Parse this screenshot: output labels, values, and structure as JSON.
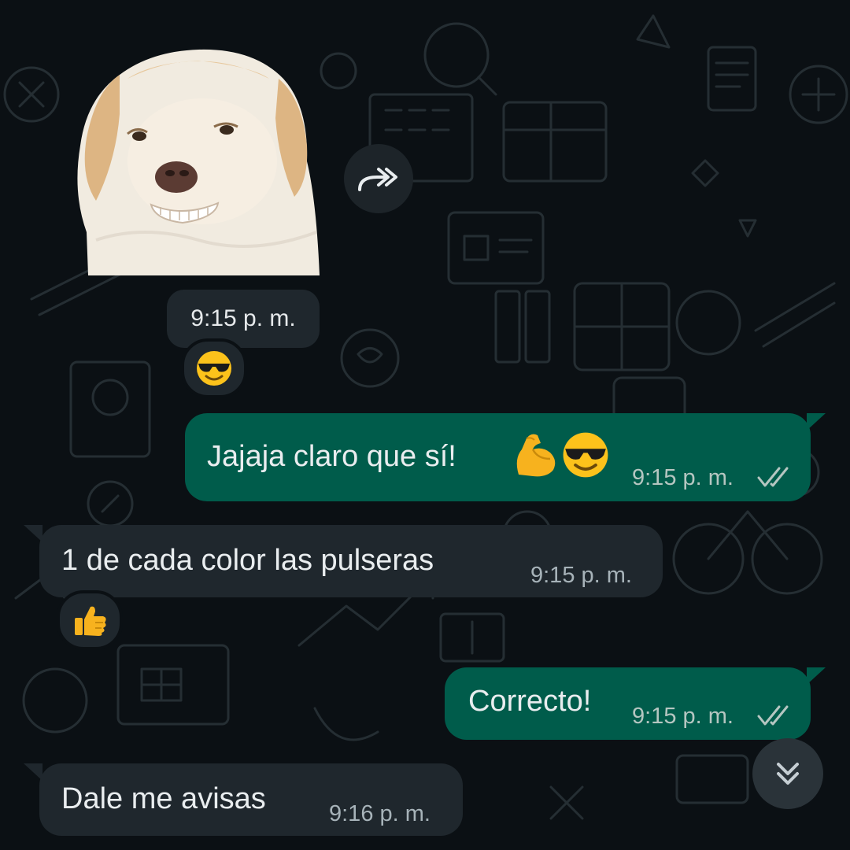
{
  "messages": {
    "sticker": {
      "time": "9:15 p. m.",
      "reaction": "smiling-face-with-sunglasses"
    },
    "msg1": {
      "text": "Jajaja claro que sí!",
      "emojis": [
        "flexed-biceps",
        "smiling-face-with-sunglasses"
      ],
      "time": "9:15 p. m.",
      "status": "read"
    },
    "msg2": {
      "text": "1 de cada color las pulseras",
      "time": "9:15 p. m.",
      "reaction": "thumbs-up"
    },
    "msg3": {
      "text": "Correcto!",
      "time": "9:15 p. m.",
      "status": "read"
    },
    "msg4": {
      "text": "Dale me avisas",
      "time": "9:16 p. m."
    }
  },
  "icons": {
    "forward": "forward-icon",
    "scroll_down": "double-chevron-down-icon"
  },
  "colors": {
    "outgoing_bubble": "#005c4b",
    "incoming_bubble": "#1f272d",
    "background": "#0b1014",
    "read_ticks": "#b5c6c1"
  }
}
